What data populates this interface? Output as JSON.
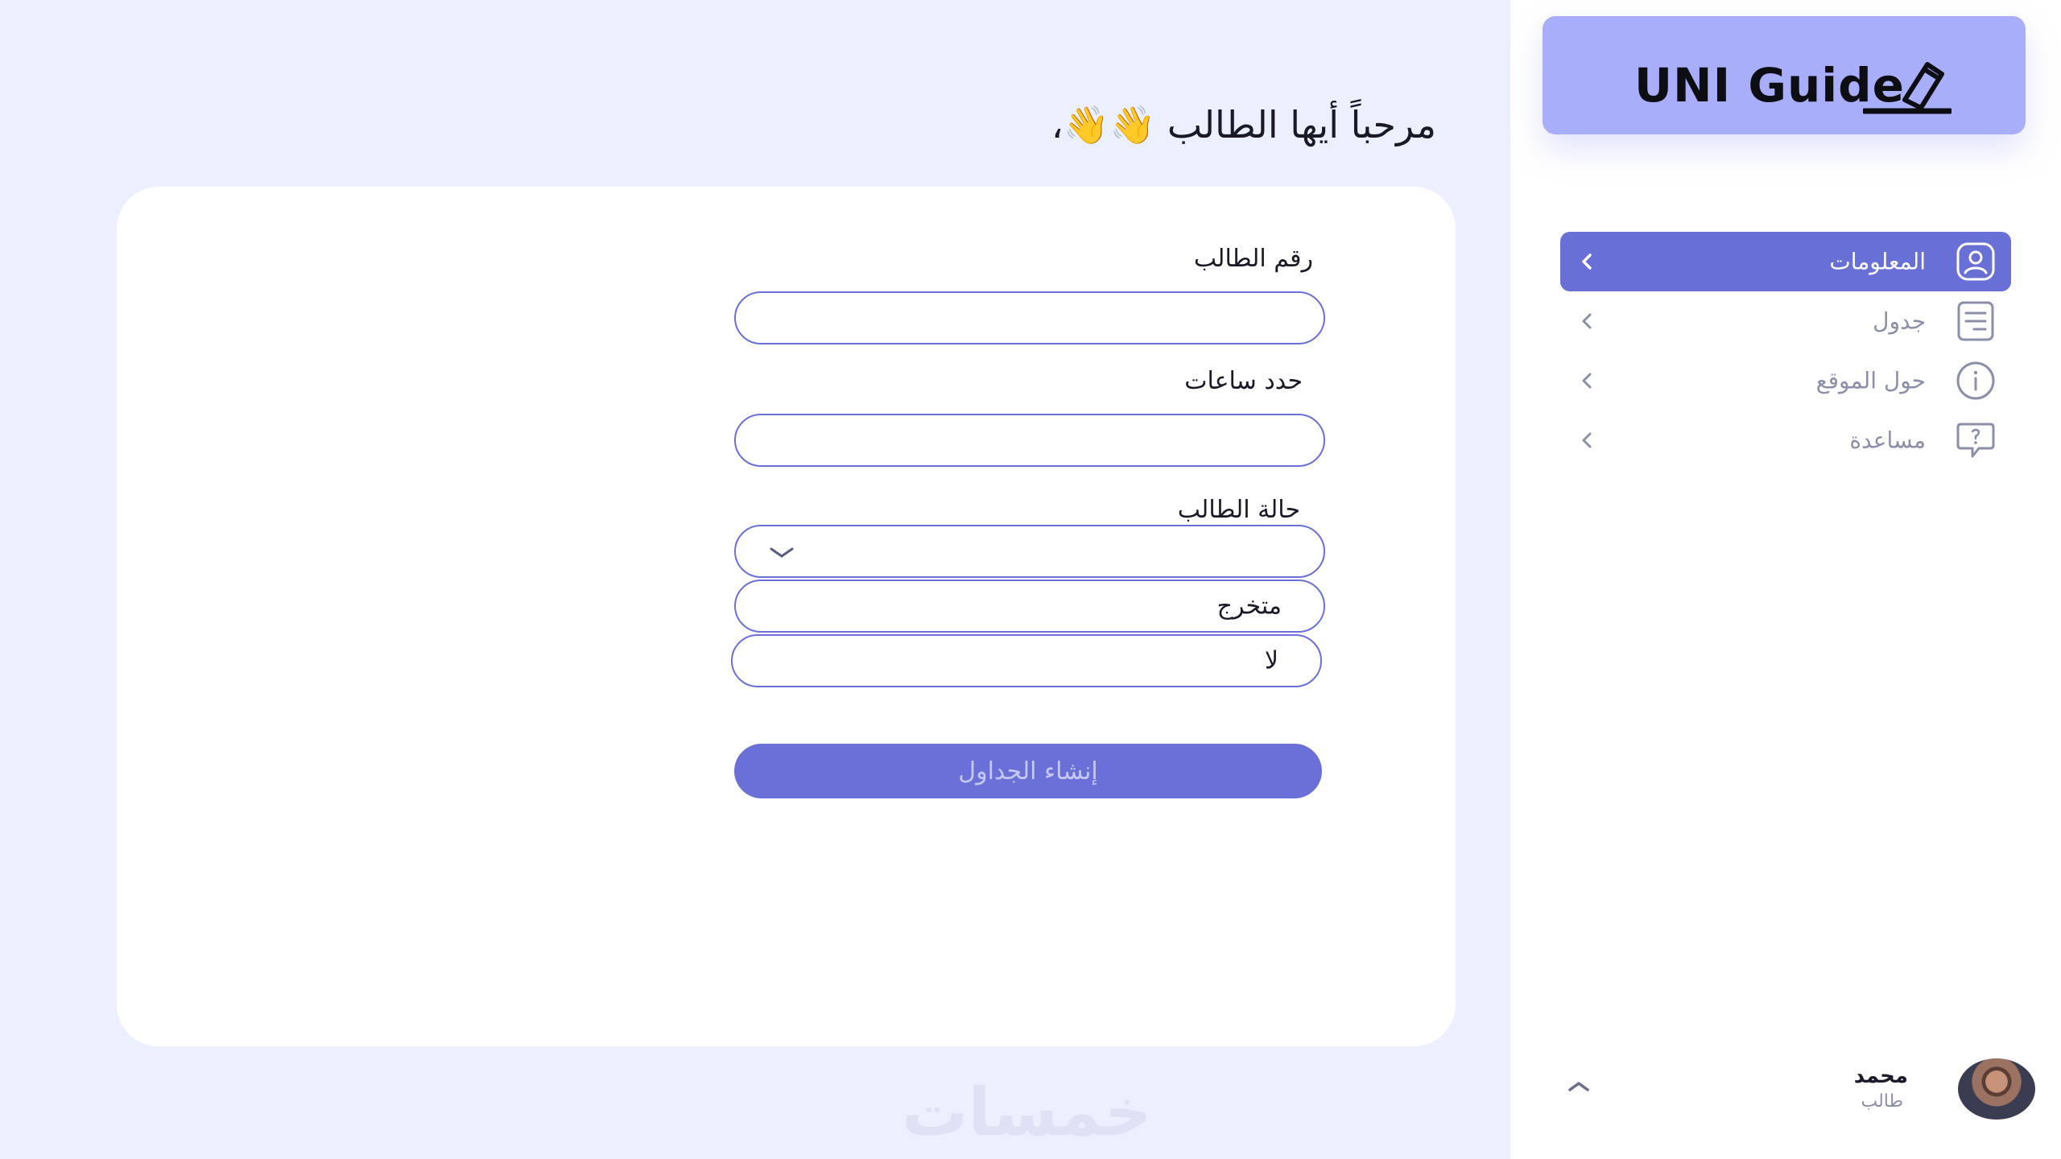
{
  "app": {
    "logo_text": "UNI Guide"
  },
  "sidebar": {
    "items": [
      {
        "label": "المعلومات",
        "icon": "user-profile-icon",
        "active": true
      },
      {
        "label": "جدول",
        "icon": "list-document-icon",
        "active": false
      },
      {
        "label": "حول الموقع",
        "icon": "info-icon",
        "active": false
      },
      {
        "label": "مساعدة",
        "icon": "help-chat-icon",
        "active": false
      }
    ],
    "user": {
      "name": "محمد",
      "role": "طالب"
    }
  },
  "main": {
    "greeting": "مرحباً أيها الطالب 👋👋،",
    "form": {
      "student_id_label": "رقم الطالب",
      "student_id_value": "",
      "hours_label": "حدد ساعات",
      "hours_value": "",
      "status_label": "حالة الطالب",
      "status_selected": "",
      "status_options": [
        "متخرج",
        "لا"
      ],
      "submit_label": "إنشاء الجداول"
    },
    "watermark": "خمسات"
  },
  "colors": {
    "accent": "#6b70d8",
    "logo_bg": "#a9aefa",
    "page_bg": "#eceffd"
  }
}
